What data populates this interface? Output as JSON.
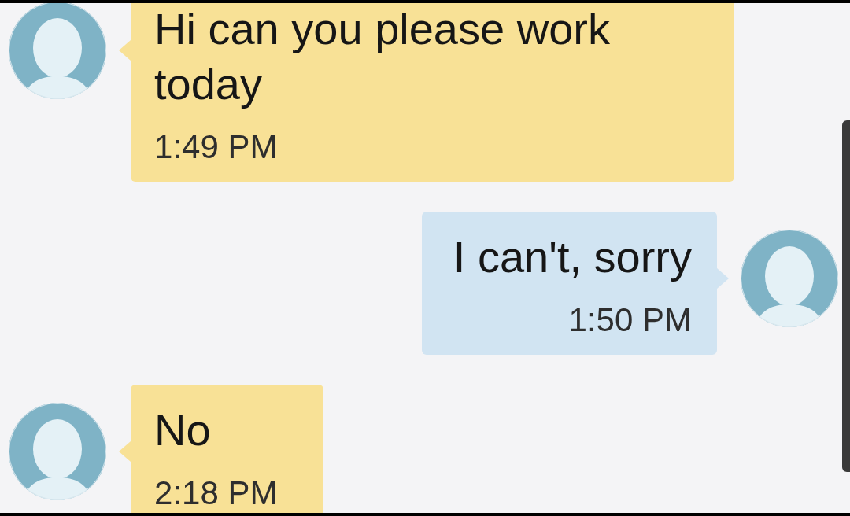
{
  "messages": [
    {
      "kind": "incoming",
      "text": "Hi can you please work today",
      "time": "1:49 PM"
    },
    {
      "kind": "outgoing",
      "text": "I can't, sorry",
      "time": "1:50 PM"
    },
    {
      "kind": "incoming",
      "text": "No",
      "time": "2:18 PM"
    }
  ]
}
